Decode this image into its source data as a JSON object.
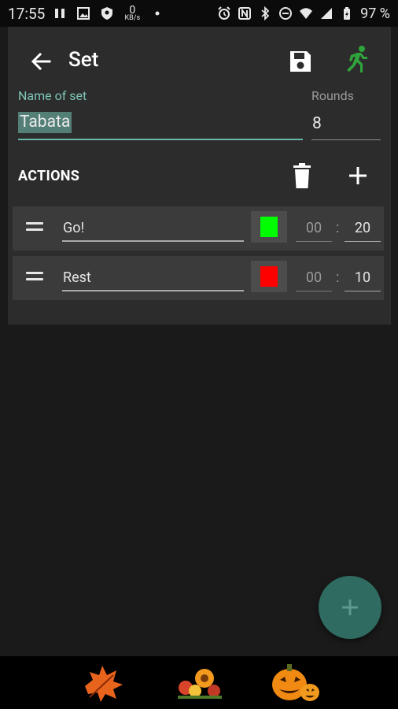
{
  "status_bar": {
    "time": "17:55",
    "network_speed_value": "0",
    "network_speed_unit": "KB/s",
    "battery_percent": "97 %"
  },
  "dialog": {
    "title": "Set",
    "name_label": "Name of set",
    "name_value": "Tabata",
    "rounds_label": "Rounds",
    "rounds_value": "8",
    "actions_label": "ACTIONS"
  },
  "actions": [
    {
      "name": "Go!",
      "color": "#00ff00",
      "minutes": "00",
      "separator": ":",
      "seconds": "20"
    },
    {
      "name": "Rest",
      "color": "#ff0000",
      "minutes": "00",
      "separator": ":",
      "seconds": "10"
    }
  ],
  "colors": {
    "accent": "#67b6a7",
    "run_icon": "#2fa43a",
    "fab": "#2f6b60"
  },
  "icons": {
    "back": "arrow-back-icon",
    "save": "save-icon",
    "run": "run-icon",
    "delete": "trash-icon",
    "add": "plus-icon",
    "fab": "plus-icon"
  }
}
